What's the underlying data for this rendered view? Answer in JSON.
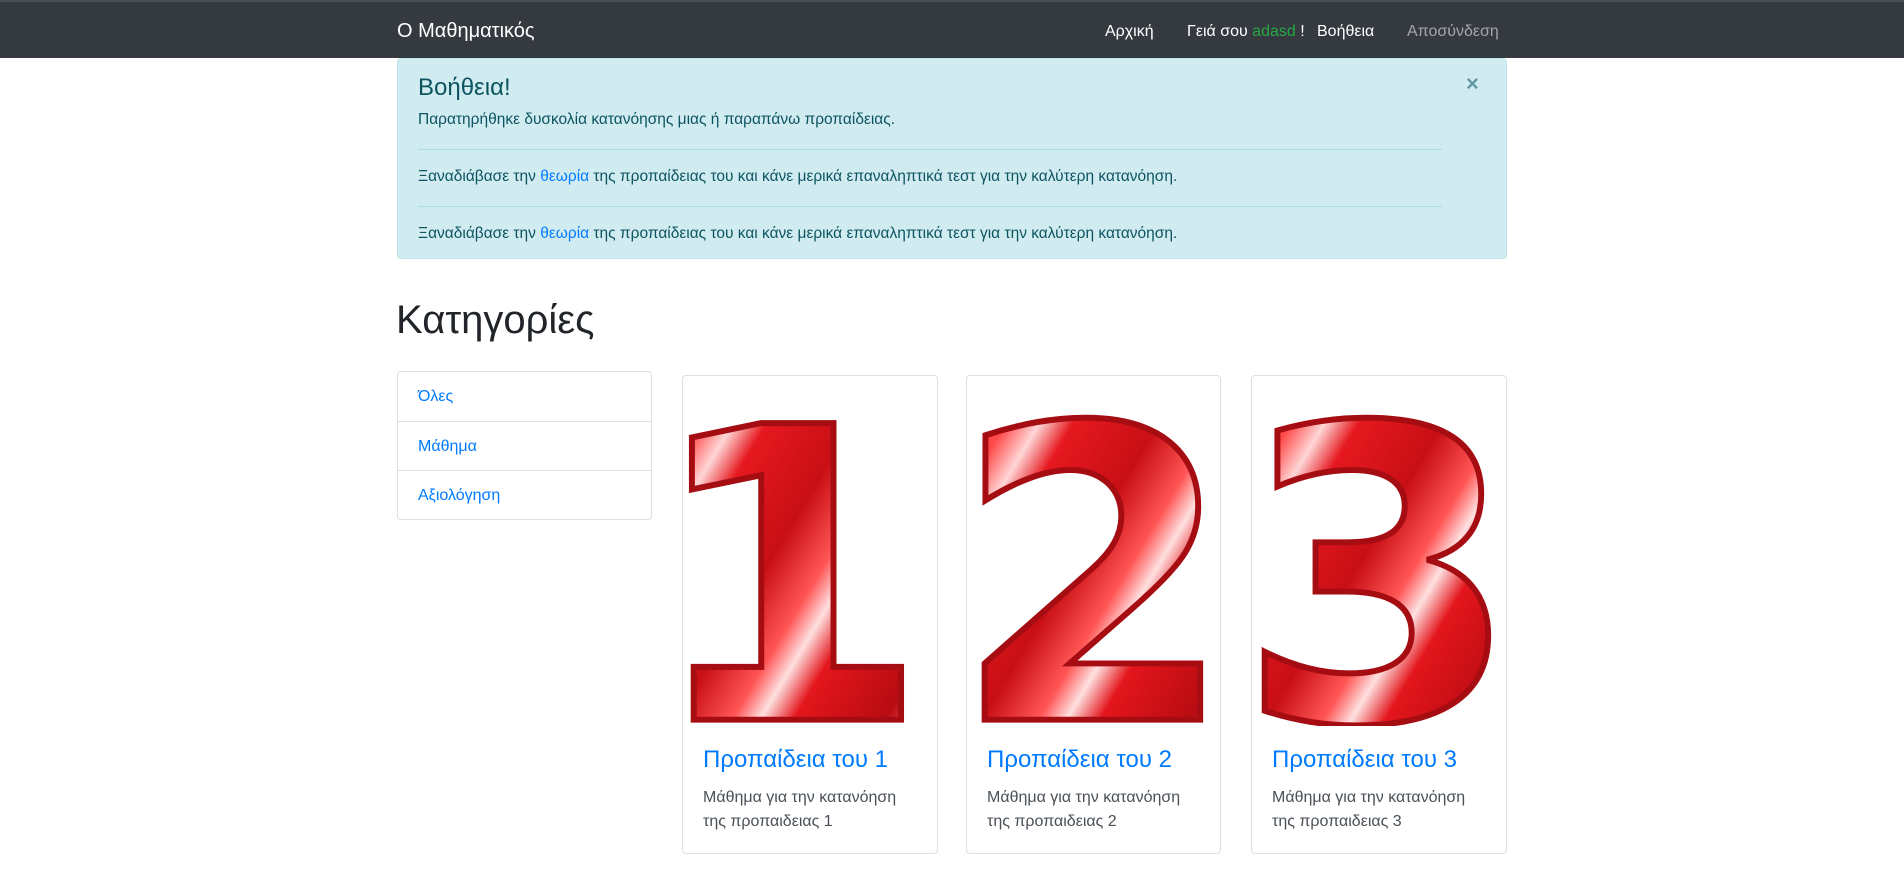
{
  "navbar": {
    "brand": "Ο Μαθηματικός",
    "home": "Αρχική",
    "greeting_prefix": "Γειά σου",
    "username": "adasd",
    "greeting_suffix": "!",
    "help": "Βοήθεια",
    "logout": "Αποσύνδεση"
  },
  "alert": {
    "heading": "Βοήθεια!",
    "close": "×",
    "line1": "Παρατηρήθηκε δυσκολία κατανόησης μιας ή παραπάνω προπαίδειας.",
    "messages": [
      {
        "before": "Ξαναδιάβασε την ",
        "link": "θεωρία",
        "after": " της προπαίδειας του και κάνε μερικά επαναληπτικά τεστ για την καλύτερη κατανόηση."
      },
      {
        "before": "Ξαναδιάβασε την ",
        "link": "θεωρία",
        "after": " της προπαίδειας του και κάνε μερικά επαναληπτικά τεστ για την καλύτερη κατανόηση."
      }
    ]
  },
  "categories": {
    "title": "Κατηγορίες",
    "items": [
      {
        "label": "Όλες"
      },
      {
        "label": "Μάθημα"
      },
      {
        "label": "Αξιολόγηση"
      }
    ]
  },
  "cards": [
    {
      "numeral": "1",
      "title": "Προπαίδεια του 1",
      "text": "Μάθημα για την κατανόηση της προπαιδειας 1"
    },
    {
      "numeral": "2",
      "title": "Προπαίδεια του 2",
      "text": "Μάθημα για την κατανόηση της προπαιδειας 2"
    },
    {
      "numeral": "3",
      "title": "Προπαίδεια του 3",
      "text": "Μάθημα για την κατανόηση της προπαιδειας 3"
    }
  ],
  "colors": {
    "navbar_bg": "#343a40",
    "alert_bg": "#d1ecf1",
    "alert_text": "#0c5460",
    "link": "#007bff",
    "username": "#28a745",
    "numeral_red": "#e21a1a"
  }
}
